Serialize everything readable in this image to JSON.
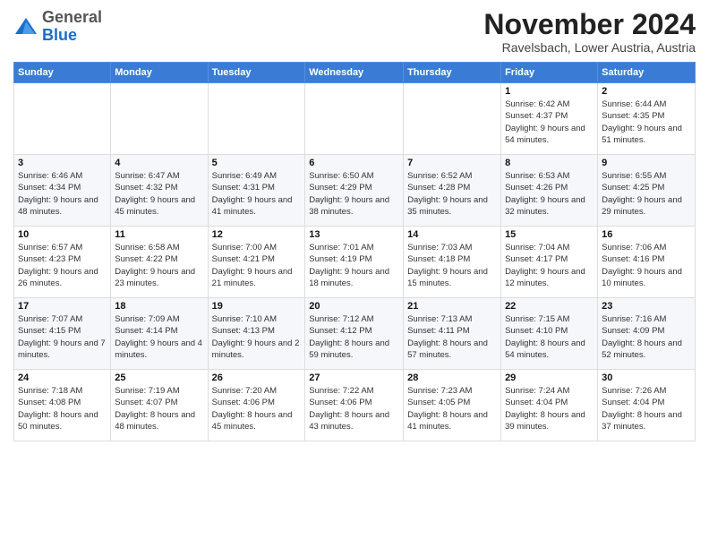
{
  "logo": {
    "general": "General",
    "blue": "Blue"
  },
  "header": {
    "month_title": "November 2024",
    "location": "Ravelsbach, Lower Austria, Austria"
  },
  "days_of_week": [
    "Sunday",
    "Monday",
    "Tuesday",
    "Wednesday",
    "Thursday",
    "Friday",
    "Saturday"
  ],
  "weeks": [
    [
      {
        "num": "",
        "info": ""
      },
      {
        "num": "",
        "info": ""
      },
      {
        "num": "",
        "info": ""
      },
      {
        "num": "",
        "info": ""
      },
      {
        "num": "",
        "info": ""
      },
      {
        "num": "1",
        "info": "Sunrise: 6:42 AM\nSunset: 4:37 PM\nDaylight: 9 hours and 54 minutes."
      },
      {
        "num": "2",
        "info": "Sunrise: 6:44 AM\nSunset: 4:35 PM\nDaylight: 9 hours and 51 minutes."
      }
    ],
    [
      {
        "num": "3",
        "info": "Sunrise: 6:46 AM\nSunset: 4:34 PM\nDaylight: 9 hours and 48 minutes."
      },
      {
        "num": "4",
        "info": "Sunrise: 6:47 AM\nSunset: 4:32 PM\nDaylight: 9 hours and 45 minutes."
      },
      {
        "num": "5",
        "info": "Sunrise: 6:49 AM\nSunset: 4:31 PM\nDaylight: 9 hours and 41 minutes."
      },
      {
        "num": "6",
        "info": "Sunrise: 6:50 AM\nSunset: 4:29 PM\nDaylight: 9 hours and 38 minutes."
      },
      {
        "num": "7",
        "info": "Sunrise: 6:52 AM\nSunset: 4:28 PM\nDaylight: 9 hours and 35 minutes."
      },
      {
        "num": "8",
        "info": "Sunrise: 6:53 AM\nSunset: 4:26 PM\nDaylight: 9 hours and 32 minutes."
      },
      {
        "num": "9",
        "info": "Sunrise: 6:55 AM\nSunset: 4:25 PM\nDaylight: 9 hours and 29 minutes."
      }
    ],
    [
      {
        "num": "10",
        "info": "Sunrise: 6:57 AM\nSunset: 4:23 PM\nDaylight: 9 hours and 26 minutes."
      },
      {
        "num": "11",
        "info": "Sunrise: 6:58 AM\nSunset: 4:22 PM\nDaylight: 9 hours and 23 minutes."
      },
      {
        "num": "12",
        "info": "Sunrise: 7:00 AM\nSunset: 4:21 PM\nDaylight: 9 hours and 21 minutes."
      },
      {
        "num": "13",
        "info": "Sunrise: 7:01 AM\nSunset: 4:19 PM\nDaylight: 9 hours and 18 minutes."
      },
      {
        "num": "14",
        "info": "Sunrise: 7:03 AM\nSunset: 4:18 PM\nDaylight: 9 hours and 15 minutes."
      },
      {
        "num": "15",
        "info": "Sunrise: 7:04 AM\nSunset: 4:17 PM\nDaylight: 9 hours and 12 minutes."
      },
      {
        "num": "16",
        "info": "Sunrise: 7:06 AM\nSunset: 4:16 PM\nDaylight: 9 hours and 10 minutes."
      }
    ],
    [
      {
        "num": "17",
        "info": "Sunrise: 7:07 AM\nSunset: 4:15 PM\nDaylight: 9 hours and 7 minutes."
      },
      {
        "num": "18",
        "info": "Sunrise: 7:09 AM\nSunset: 4:14 PM\nDaylight: 9 hours and 4 minutes."
      },
      {
        "num": "19",
        "info": "Sunrise: 7:10 AM\nSunset: 4:13 PM\nDaylight: 9 hours and 2 minutes."
      },
      {
        "num": "20",
        "info": "Sunrise: 7:12 AM\nSunset: 4:12 PM\nDaylight: 8 hours and 59 minutes."
      },
      {
        "num": "21",
        "info": "Sunrise: 7:13 AM\nSunset: 4:11 PM\nDaylight: 8 hours and 57 minutes."
      },
      {
        "num": "22",
        "info": "Sunrise: 7:15 AM\nSunset: 4:10 PM\nDaylight: 8 hours and 54 minutes."
      },
      {
        "num": "23",
        "info": "Sunrise: 7:16 AM\nSunset: 4:09 PM\nDaylight: 8 hours and 52 minutes."
      }
    ],
    [
      {
        "num": "24",
        "info": "Sunrise: 7:18 AM\nSunset: 4:08 PM\nDaylight: 8 hours and 50 minutes."
      },
      {
        "num": "25",
        "info": "Sunrise: 7:19 AM\nSunset: 4:07 PM\nDaylight: 8 hours and 48 minutes."
      },
      {
        "num": "26",
        "info": "Sunrise: 7:20 AM\nSunset: 4:06 PM\nDaylight: 8 hours and 45 minutes."
      },
      {
        "num": "27",
        "info": "Sunrise: 7:22 AM\nSunset: 4:06 PM\nDaylight: 8 hours and 43 minutes."
      },
      {
        "num": "28",
        "info": "Sunrise: 7:23 AM\nSunset: 4:05 PM\nDaylight: 8 hours and 41 minutes."
      },
      {
        "num": "29",
        "info": "Sunrise: 7:24 AM\nSunset: 4:04 PM\nDaylight: 8 hours and 39 minutes."
      },
      {
        "num": "30",
        "info": "Sunrise: 7:26 AM\nSunset: 4:04 PM\nDaylight: 8 hours and 37 minutes."
      }
    ]
  ]
}
